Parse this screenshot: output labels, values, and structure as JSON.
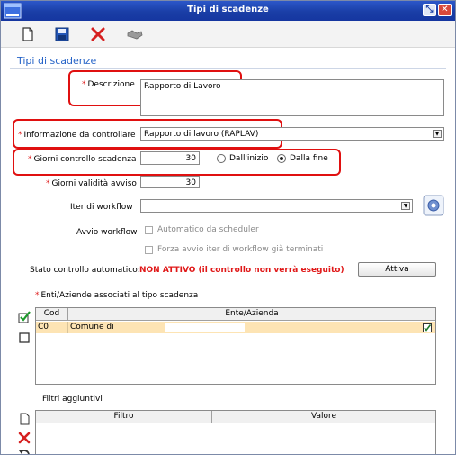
{
  "window": {
    "title": "Tipi di scadenze",
    "icon": "app-window-icon",
    "buttons": {
      "minimize": "minimize-icon",
      "close": "close-icon"
    }
  },
  "toolbar": {
    "items": [
      {
        "name": "new-document-icon"
      },
      {
        "name": "save-icon"
      },
      {
        "name": "delete-icon"
      },
      {
        "name": "handshake-icon"
      }
    ]
  },
  "form": {
    "section_title": "Tipi di scadenze",
    "descrizione": {
      "label": "Descrizione",
      "value": "Rapporto di Lavoro"
    },
    "informazione": {
      "label": "Informazione da controllare",
      "value": "Rapporto di lavoro (RAPLAV)"
    },
    "giorni_controllo": {
      "label": "Giorni controllo scadenza",
      "value": "30",
      "option_inizio": "Dall'inizio",
      "option_fine": "Dalla fine",
      "selected": "Dalla fine"
    },
    "giorni_validita": {
      "label": "Giorni validità avviso",
      "value": "30"
    },
    "iter_workflow": {
      "label": "Iter di workflow",
      "value": ""
    },
    "avvio_workflow": {
      "label": "Avvio workflow",
      "opt1": "Automatico da scheduler",
      "opt2": "Forza avvio iter di workflow già terminati"
    },
    "stato": {
      "label": "Stato controllo automatico:",
      "value": "NON ATTIVO (il controllo non verrà eseguito)",
      "button": "Attiva"
    },
    "required_mark": "*"
  },
  "enti": {
    "title": "Enti/Aziende associati al tipo scadenza",
    "columns": [
      "Cod",
      "Ente/Azienda"
    ],
    "rows": [
      {
        "cod": "C0",
        "ente": "Comune di"
      }
    ]
  },
  "filtri": {
    "title": "Filtri aggiuntivi",
    "columns": [
      "Filtro",
      "Valore"
    ]
  },
  "colors": {
    "title_bar": "#1a3ea6",
    "section_title": "#2563c7",
    "required": "#e02020",
    "status_inactive": "#e01818",
    "highlight_box": "#e01010",
    "selected_row": "#fde4b4"
  }
}
